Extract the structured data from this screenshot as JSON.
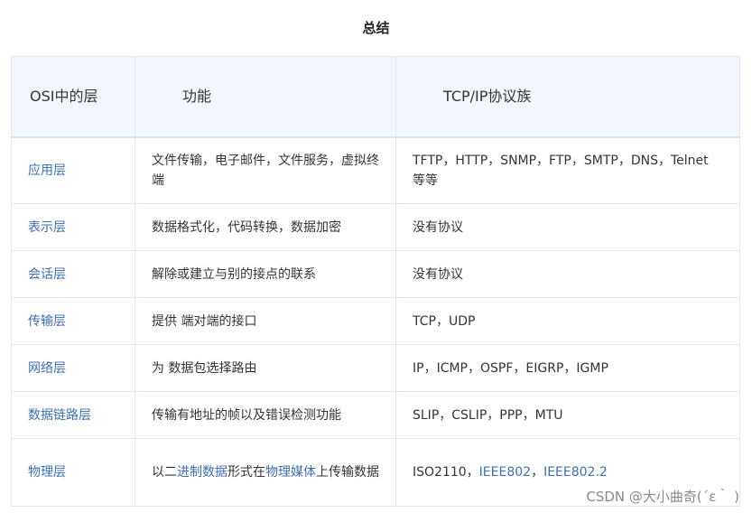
{
  "title": "总结",
  "headers": {
    "layer": "OSI中的层",
    "function": "功能",
    "protocol": "TCP/IP协议族"
  },
  "rows": [
    {
      "layer": "应用层",
      "function": "文件传输，电子邮件，文件服务，虚拟终端",
      "protocol": "TFTP，HTTP，SNMP，FTP，SMTP，DNS，Telnet 等等"
    },
    {
      "layer": "表示层",
      "function": "数据格式化，代码转换，数据加密",
      "protocol": "没有协议"
    },
    {
      "layer": "会话层",
      "function": "解除或建立与别的接点的联系",
      "protocol": "没有协议"
    },
    {
      "layer": "传输层",
      "function": "提供 端对端的接口",
      "protocol": "TCP，UDP"
    },
    {
      "layer": "网络层",
      "function": "为 数据包选择路由",
      "protocol": "IP，ICMP，OSPF，EIGRP，IGMP"
    },
    {
      "layer": "数据链路层",
      "function": "传输有地址的帧以及错误检测功能",
      "protocol": "SLIP，CSLIP，PPP，MTU"
    },
    {
      "layer": "物理层",
      "function_parts": {
        "p1": "以二",
        "link1": "进制数据",
        "p2": "形式在",
        "link2": "物理媒体",
        "p3": "上传输数据"
      },
      "protocol_parts": {
        "p1": "ISO2110，",
        "link1": "IEEE802",
        "p2": "，",
        "link2": "IEEE802.2"
      }
    }
  ],
  "watermark": "CSDN @大小曲奇(´ε｀ )",
  "colors": {
    "link": "#3d6fb6",
    "header_bg": "#f1f6fc",
    "border": "#e3e8ef"
  }
}
